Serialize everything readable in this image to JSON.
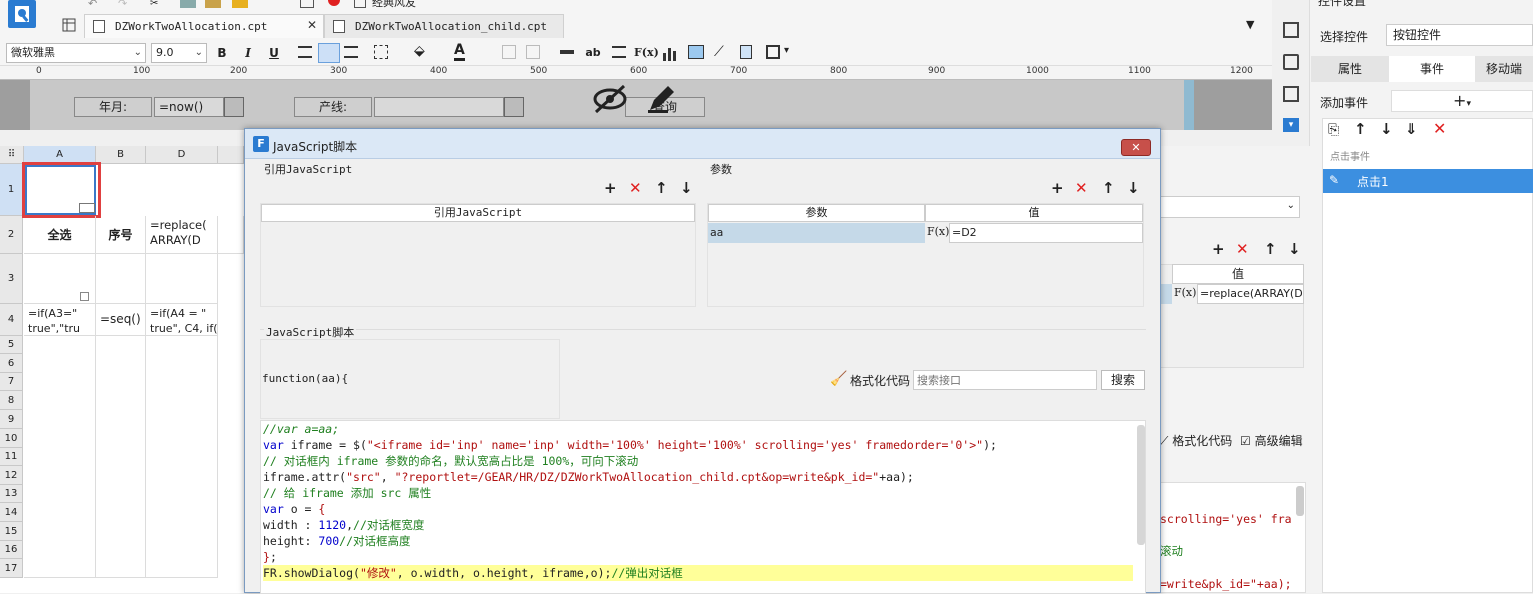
{
  "app": {
    "tabs": [
      {
        "label": "DZWorkTwoAllocation.cpt",
        "icon": "report-icon"
      },
      {
        "label": "DZWorkTwoAllocation_child.cpt",
        "icon": "report-icon"
      }
    ],
    "top_partial_label": "经典风友"
  },
  "format_toolbar": {
    "font_family": "微软雅黑",
    "font_size": "9.0",
    "bold": "B",
    "italic": "I",
    "underline": "U",
    "fx": "F(x)",
    "ab": "ab"
  },
  "ruler_ticks": [
    "0",
    "100",
    "200",
    "300",
    "400",
    "500",
    "600",
    "700",
    "800",
    "900",
    "1000",
    "1100",
    "1200"
  ],
  "param_canvas": {
    "label_month": "年月:",
    "field_month": "=now()",
    "label_line": "产线:",
    "field_line": "",
    "query_button": "查询"
  },
  "grid": {
    "col_headers": [
      "A",
      "B",
      "D"
    ],
    "row_headers": [
      "1 (H)",
      "2 (H)",
      "3 (H)",
      "4",
      "5",
      "6",
      "7",
      "8",
      "9",
      "10",
      "11",
      "12",
      "13",
      "14",
      "15",
      "16",
      "17"
    ],
    "cells": {
      "a2": "全选",
      "b2": "序号",
      "d2": "=replace(\nARRAY(D",
      "a4": "=if(A3=\"\ntrue\",\"tru",
      "b4": "=seq()",
      "d4": "=if(A4 = \"\ntrue\", C4, if("
    }
  },
  "right_panel": {
    "header_partial": "控件设置",
    "select_control_label": "选择控件",
    "select_control_value": "按钮控件",
    "tabs": [
      "属性",
      "事件",
      "移动端"
    ],
    "add_event_label": "添加事件",
    "event_group": "点击事件",
    "event_item": "点击1"
  },
  "back_panel": {
    "col_value": "值",
    "param_value": "=replace(ARRAY(D",
    "format_code": "格式化代码",
    "advanced_edit": "高级编辑",
    "code_fragments": [
      "scrolling='yes' fra",
      "滚动",
      "=write&pk_id=\"+aa);"
    ]
  },
  "dialog": {
    "title": "JavaScript脚本",
    "ref_js_label": "引用JavaScript",
    "ref_js_header": "引用JavaScript",
    "params_label": "参数",
    "params_col_name": "参数",
    "params_col_value": "值",
    "param_rows": [
      {
        "name": "aa",
        "value": "=D2"
      }
    ],
    "script_label": "JavaScript脚本",
    "function_sig": "function(aa){",
    "format_code": "格式化代码",
    "search_placeholder": "搜索接口",
    "search_button": "搜索",
    "code_lines": [
      "//var a=aa;",
      "var iframe = $(\"<iframe id='inp' name='inp' width='100%' height='100%' scrolling='yes' framedorder='0'>\");",
      "// 对话框内 iframe 参数的命名，默认宽高占比是 100%，可向下滚动",
      "iframe.attr(\"src\", \"?reportlet=/GEAR/HR/DZ/DZWorkTwoAllocation_child.cpt&op=write&pk_id=\"+aa);",
      "// 给 iframe 添加 src 属性",
      "var o = {",
      "width : 1120,//对话框宽度",
      "height: 700//对话框高度",
      "};",
      "FR.showDialog(\"修改\", o.width, o.height, iframe,o);//弹出对话框"
    ]
  },
  "colors": {
    "accent": "#2a7bd1",
    "selection_red": "#e04040",
    "event_selected": "#3c8fe0",
    "highlight_line": "#ffff99"
  }
}
